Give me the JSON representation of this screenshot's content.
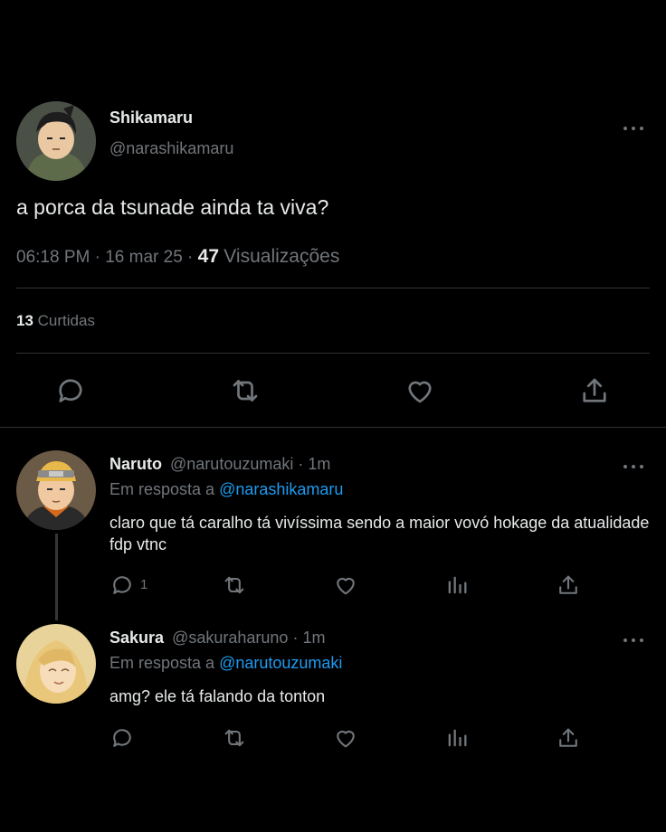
{
  "main_tweet": {
    "display_name": "Shikamaru",
    "handle": "@narashikamaru",
    "text": "a porca da tsunade ainda ta viva?",
    "time": "06:18 PM",
    "sep1": "·",
    "date": "16 mar 25",
    "sep2": "·",
    "views_count": "47",
    "views_label": "Visualizações",
    "likes_count": "13",
    "likes_label": "Curtidas",
    "actions": [
      "reply-icon",
      "retweet-icon",
      "like-icon",
      "share-icon"
    ]
  },
  "replies": [
    {
      "display_name": "Naruto",
      "handle": "@narutouzumaki",
      "sep": "·",
      "time": "1m",
      "reply_prefix": "Em resposta a",
      "reply_to": "@narashikamaru",
      "text": "claro que tá caralho tá vivíssima sendo a maior vovó hokage da atualidade fdp vtnc",
      "reply_count": "1",
      "actions": [
        "reply-icon",
        "retweet-icon",
        "like-icon",
        "analytics-icon",
        "share-icon"
      ]
    },
    {
      "display_name": "Sakura",
      "handle": "@sakuraharuno",
      "sep": "·",
      "time": "1m",
      "reply_prefix": "Em resposta a",
      "reply_to": "@narutouzumaki",
      "text": "amg? ele tá falando da tonton",
      "actions": [
        "reply-icon",
        "retweet-icon",
        "like-icon",
        "analytics-icon",
        "share-icon"
      ]
    }
  ],
  "colors": {
    "background": "#000000",
    "text": "#e7e9ea",
    "muted": "#71767b",
    "link": "#1d9bf0",
    "divider": "#2f3336"
  }
}
